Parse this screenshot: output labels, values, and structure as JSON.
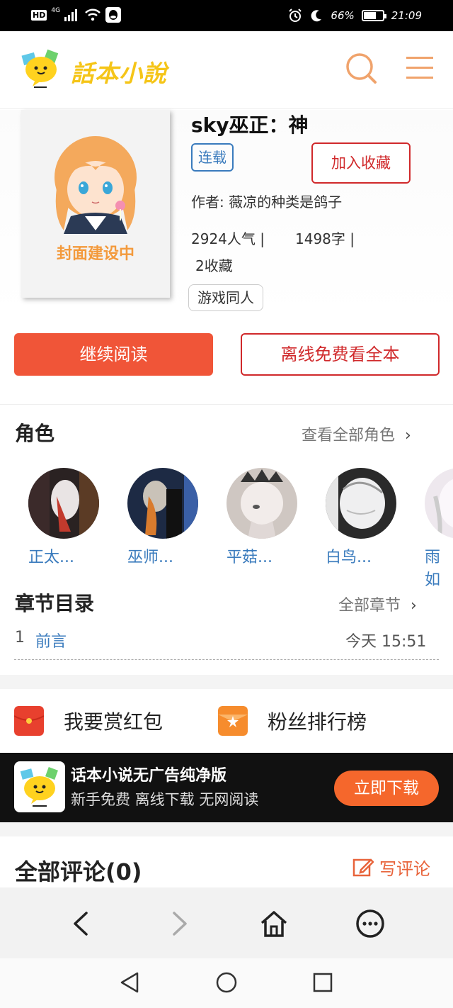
{
  "status_bar": {
    "network_badge": "HD",
    "network_type": "4G",
    "battery_text": "66%",
    "battery_level": 0.66,
    "time": "21:09"
  },
  "header": {
    "logo_text": "話本小說",
    "search_icon": "search-icon",
    "menu_icon": "menu-icon"
  },
  "book": {
    "cover_text": "封面建设中",
    "title": "sky巫正：神",
    "status_badge": "连载",
    "favorite_label": "加入收藏",
    "author": "作者: 薇凉的种类是鸽子",
    "popularity": "2924人气 |",
    "word_count": "1498字 |",
    "favorites": "2收藏",
    "tag": "游戏同人"
  },
  "actions": {
    "continue_reading": "继续阅读",
    "offline_read": "离线免费看全本"
  },
  "characters": {
    "title": "角色",
    "more": "查看全部角色",
    "items": [
      {
        "name": "正太..."
      },
      {
        "name": "巫师..."
      },
      {
        "name": "平菇..."
      },
      {
        "name": "白鸟..."
      },
      {
        "name": "雨如"
      }
    ]
  },
  "chapters": {
    "title": "章节目录",
    "more": "全部章节",
    "items": [
      {
        "number": "1",
        "title": "前言",
        "time": "今天 15:51"
      }
    ]
  },
  "extras": {
    "reward": "我要赏红包",
    "ranking": "粉丝排行榜"
  },
  "ad": {
    "title": "话本小说无广告纯净版",
    "subtitle": "新手免费 离线下载 无网阅读",
    "button": "立即下载"
  },
  "comments": {
    "title": "全部评论(0)",
    "write": "写评论"
  },
  "colors": {
    "accent_red": "#f05538",
    "brand_yellow": "#f5c518",
    "link_blue": "#3a7bbd",
    "header_orange": "#f0a36c"
  }
}
